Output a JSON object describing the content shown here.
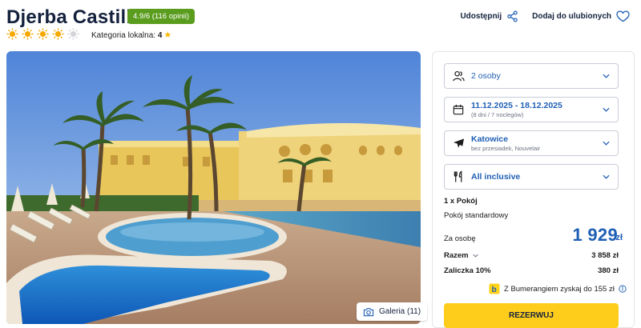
{
  "hotel": {
    "name": "Djerba Castille",
    "rating_badge": "4.9/6 (116 opinii)",
    "stars_filled": 4,
    "stars_total": 5,
    "local_category_label": "Kategoria lokalna:",
    "local_category_value": "4"
  },
  "actions": {
    "share_label": "Udostępnij",
    "favorite_label": "Dodaj do ulubionych"
  },
  "gallery": {
    "label": "Galeria (11)"
  },
  "booking": {
    "persons": "2 osoby",
    "dates": "11.12.2025 - 18.12.2025",
    "dates_sub": "(8 dni / 7 noclegów)",
    "departure": "Katowice",
    "departure_sub": "bez przesiadek, Nouvelair",
    "board": "All inclusive",
    "room_count": "1 x Pokój",
    "room_type": "Pokój standardowy",
    "per_person_label": "Za osobę",
    "per_person_price": "1 929",
    "currency": "zł",
    "total_label": "Razem",
    "total_value": "3 858 zł",
    "deposit_label": "Zaliczka 10%",
    "deposit_value": "380 zł",
    "bumerang_text": "Z Bumerangiem zyskaj do 155 zł",
    "reserve_label": "REZERWUJ"
  },
  "colors": {
    "accent_blue": "#1f5fb5",
    "badge_green": "#5a9d1e",
    "reserve_yellow": "#fecd1c",
    "sun_orange": "#f6a800"
  }
}
